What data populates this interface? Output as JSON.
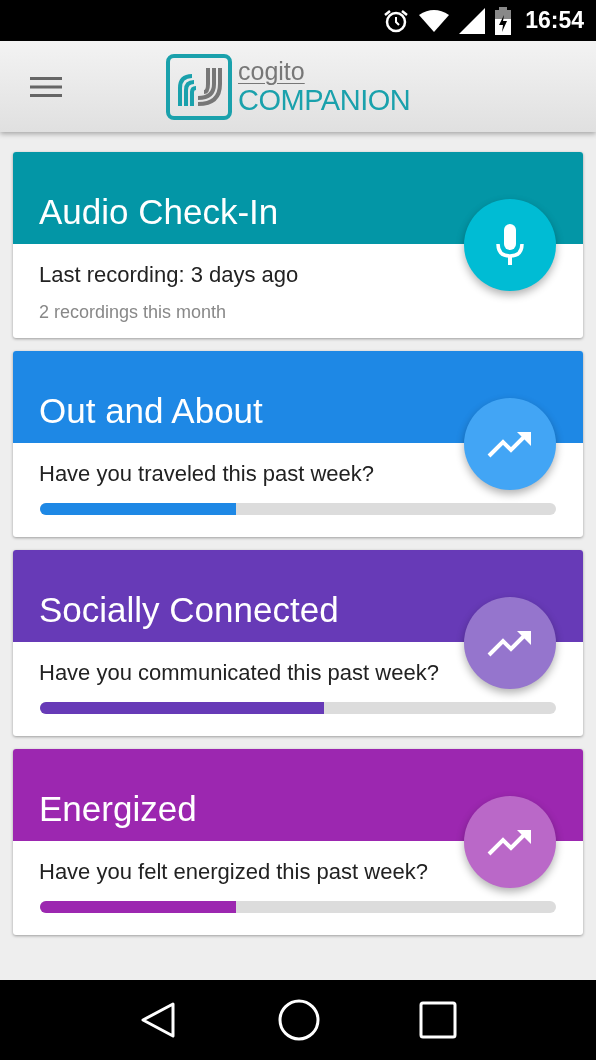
{
  "status_bar": {
    "time": "16:54"
  },
  "app_bar": {
    "logo_top": "cogito",
    "logo_bottom": "COMPANION"
  },
  "cards": [
    {
      "kind": "audio",
      "title": "Audio Check-In",
      "color": "#0396a6",
      "fab": {
        "color": "#00bcd4"
      },
      "line": "Last recording: 3 days ago",
      "subline": "2 recordings this month"
    },
    {
      "kind": "survey",
      "title": "Out and About",
      "color": "#1e88e5",
      "fab": {
        "color": "#42a5f5"
      },
      "line": "Have you traveled this past week?",
      "level": 0.38
    },
    {
      "kind": "survey",
      "title": "Socially Connected",
      "color": "#673ab7",
      "fab": {
        "color": "#9575cd"
      },
      "line": "Have you communicated this past week?",
      "level": 0.55
    },
    {
      "kind": "survey",
      "title": "Energized",
      "color": "#9c27b0",
      "fab": {
        "color": "#ba68c8"
      },
      "line": "Have you felt energized this past week?",
      "level": 0.38
    }
  ]
}
